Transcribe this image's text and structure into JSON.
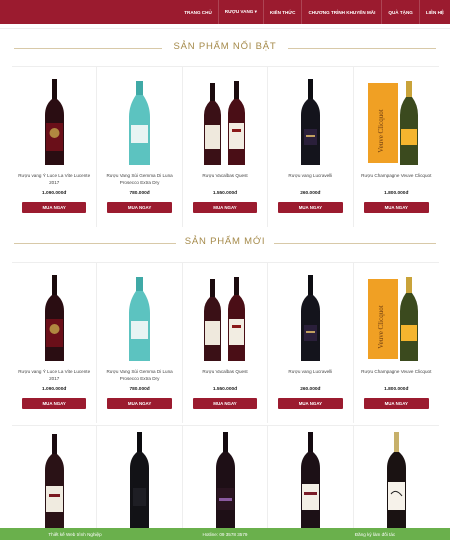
{
  "nav": {
    "items": [
      "TRANG CHỦ",
      "RƯỢU VANG ▾",
      "KIẾN THỨC",
      "CHƯƠNG TRÌNH KHUYẾN MÃI",
      "QUÀ TẶNG",
      "LIÊN HỆ"
    ]
  },
  "sections": {
    "featured_title": "SẢN PHẨM NỔI BẬT",
    "new_title": "SẢN PHẨM MỚI"
  },
  "featured": [
    {
      "name": "Rượu vang Ý Luce La Vite Lucente 2017",
      "price": "1.090.000đ",
      "buy": "MUA NGAY",
      "icon": "dark-red-wine-bottle"
    },
    {
      "name": "Rượu Vang Sủi Gemma Di Luna Prosecco Extra Dry",
      "price": "780.000đ",
      "buy": "MUA NGAY",
      "icon": "teal-sparkling-bottle"
    },
    {
      "name": "Rượu Vacalbas Quest",
      "price": "1.550.000đ",
      "buy": "MUA NGAY",
      "icon": "two-wine-bottles"
    },
    {
      "name": "Rượu vang Lucravelli",
      "price": "260.000đ",
      "buy": "MUA NGAY",
      "icon": "black-wine-bottle"
    },
    {
      "name": "Rượu Champagne Veuve Clicquot",
      "price": "1.800.000đ",
      "buy": "MUA NGAY",
      "icon": "champagne-with-box"
    }
  ],
  "new": [
    {
      "name": "Rượu vang Ý Luce La Vite Lucente 2017",
      "price": "1.090.000đ",
      "buy": "MUA NGAY",
      "icon": "dark-red-wine-bottle"
    },
    {
      "name": "Rượu Vang Sủi Gemma Di Luna Prosecco Extra Dry",
      "price": "780.000đ",
      "buy": "MUA NGAY",
      "icon": "teal-sparkling-bottle"
    },
    {
      "name": "Rượu Vacalbas Quest",
      "price": "1.550.000đ",
      "buy": "MUA NGAY",
      "icon": "two-wine-bottles"
    },
    {
      "name": "Rượu vang Lucravelli",
      "price": "260.000đ",
      "buy": "MUA NGAY",
      "icon": "black-wine-bottle"
    },
    {
      "name": "Rượu Champagne Veuve Clicquot",
      "price": "1.800.000đ",
      "buy": "MUA NGAY",
      "icon": "champagne-with-box"
    }
  ],
  "bottom_bar": {
    "left": "Thiết kế Web trình Nghiệp",
    "middle": "Hotline: 09 3578 3579",
    "right": "Đăng ký làm đối tác"
  },
  "colors": {
    "brand_red": "#9b1b2f",
    "gold_title": "#a58a4a",
    "bottom_green": "#6ab04c"
  }
}
